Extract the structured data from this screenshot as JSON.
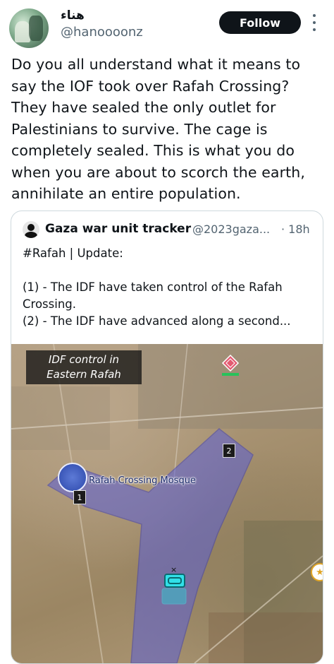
{
  "author": {
    "display_name": "هناء",
    "handle": "@hanoooonz",
    "follow_label": "Follow"
  },
  "tweet": {
    "text": "Do you all understand what it means to\nsay the IOF took over Rafah Crossing?\nThey have sealed the only outlet for\nPalestinians to survive. The cage is\ncompletely sealed. This is what you do\nwhen you are about to scorch the earth,\nannihilate an entire population."
  },
  "quote": {
    "name": "Gaza war unit tracker",
    "handle": "@2023gaza...",
    "time": "· 18h",
    "text": "#Rafah | Update:\n\n(1) - The IDF have taken control of the Rafah\nCrossing.\n(2) - The IDF have advanced along a second..."
  },
  "map": {
    "label_line1": "IDF control in",
    "label_line2": "Eastern Rafah",
    "mosque_label": "Rafah Crossing Mosque",
    "marker_1": "1",
    "marker_2": "2",
    "close_glyph": "×",
    "control_area_color": "#5b5fd6"
  },
  "icons": {
    "more": "more-vertical-icon",
    "avatar": "profile-avatar"
  }
}
